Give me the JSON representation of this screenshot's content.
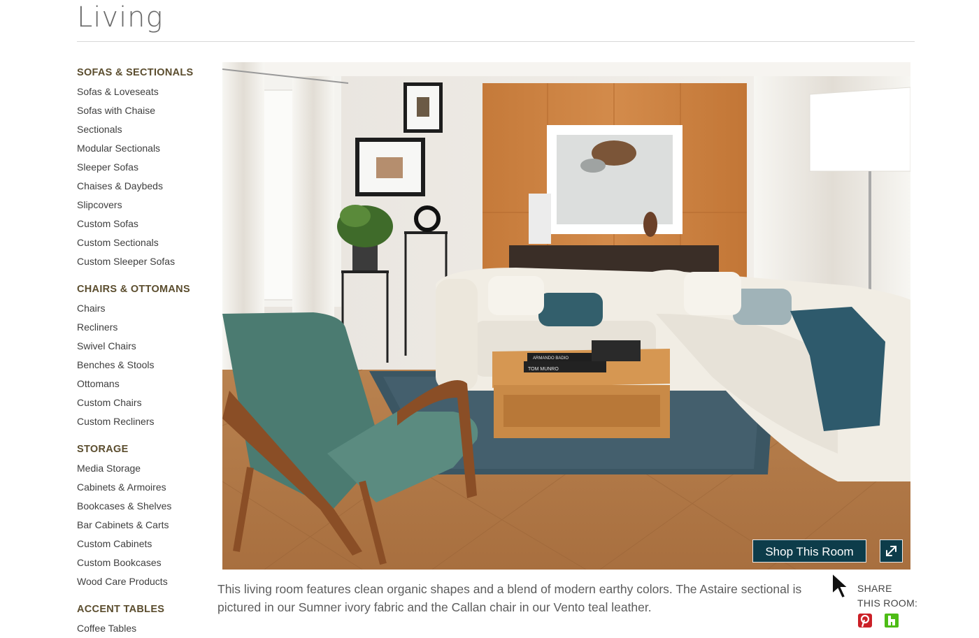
{
  "page": {
    "title": "Living"
  },
  "sidebar": {
    "categories": [
      {
        "title": "SOFAS & SECTIONALS",
        "items": [
          "Sofas & Loveseats",
          "Sofas with Chaise",
          "Sectionals",
          "Modular Sectionals",
          "Sleeper Sofas",
          "Chaises & Daybeds",
          "Slipcovers",
          "Custom Sofas",
          "Custom Sectionals",
          "Custom Sleeper Sofas"
        ]
      },
      {
        "title": "CHAIRS & OTTOMANS",
        "items": [
          "Chairs",
          "Recliners",
          "Swivel Chairs",
          "Benches & Stools",
          "Ottomans",
          "Custom Chairs",
          "Custom Recliners"
        ]
      },
      {
        "title": "STORAGE",
        "items": [
          "Media Storage",
          "Cabinets & Armoires",
          "Bookcases & Shelves",
          "Bar Cabinets & Carts",
          "Custom Cabinets",
          "Custom Bookcases",
          "Wood Care Products"
        ]
      },
      {
        "title": "ACCENT TABLES",
        "items": [
          "Coffee Tables"
        ]
      }
    ]
  },
  "room": {
    "shop_button": "Shop This Room",
    "books": {
      "top": "ARMANDO BADIO",
      "bottom": "TOM MUNRO"
    }
  },
  "caption": {
    "line1": "This living room features clean organic shapes and a blend of modern earthy colors. The Astaire sectional is",
    "line2": "pictured in our Sumner ivory fabric and the Callan chair in our Vento teal leather."
  },
  "share": {
    "line1": "SHARE",
    "line2": "THIS ROOM:"
  },
  "colors": {
    "brand_dark": "#0d3c4a",
    "category": "#5b4d2e",
    "pinterest": "#cb2027",
    "houzz": "#4dbc15"
  },
  "icons": [
    "expand-icon",
    "pinterest-icon",
    "houzz-icon",
    "mouse-cursor-icon"
  ]
}
